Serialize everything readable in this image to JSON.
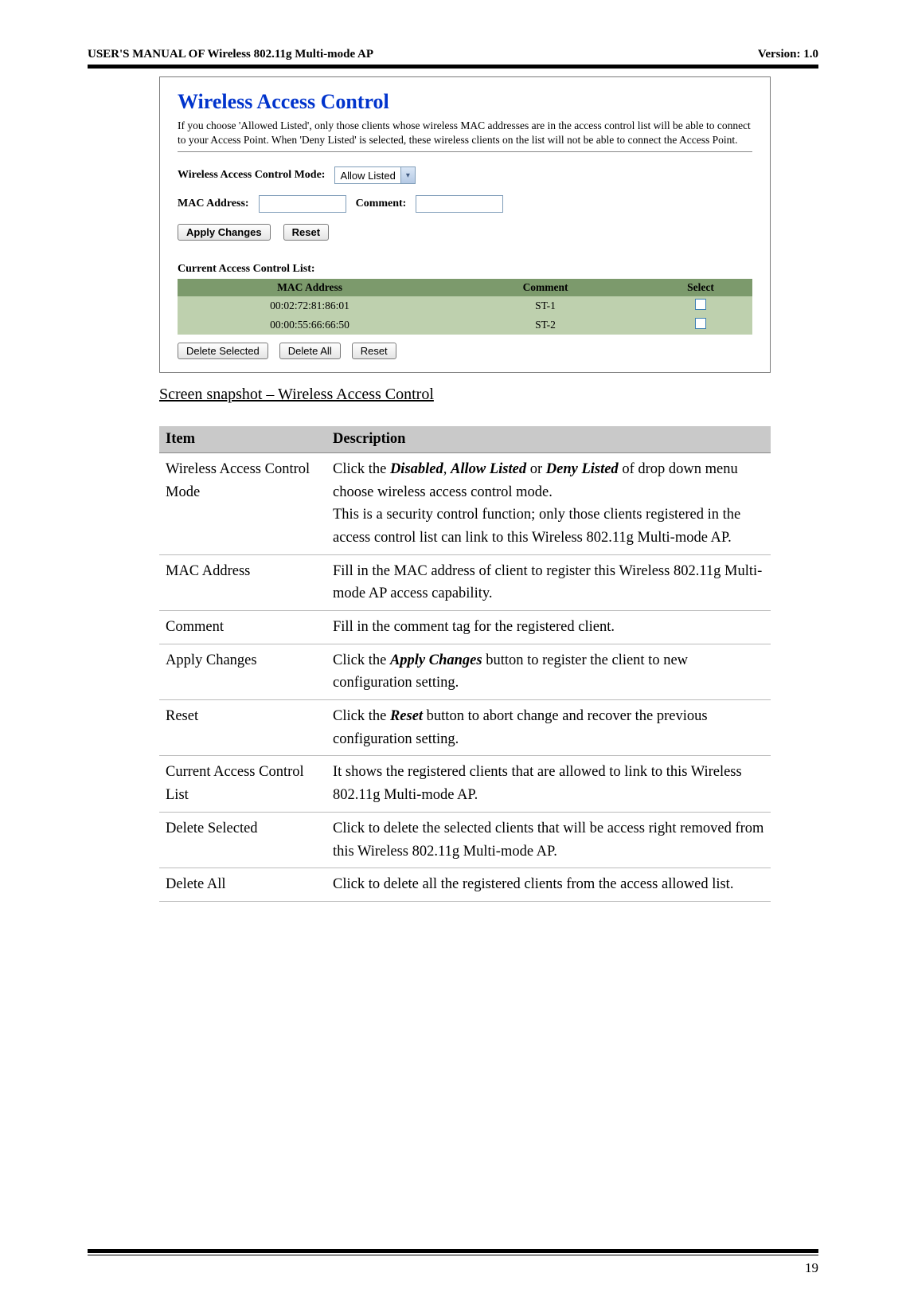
{
  "header": {
    "left": "USER'S MANUAL OF Wireless 802.11g Multi-mode AP",
    "right": "Version: 1.0"
  },
  "panel": {
    "title": "Wireless Access Control",
    "desc": "If you choose 'Allowed Listed', only those clients whose wireless MAC addresses are in the access control list will be able to connect to your Access Point. When 'Deny Listed' is selected, these wireless clients on the list will not be able to connect the Access Point.",
    "mode_label": "Wireless Access Control Mode:",
    "mode_value": "Allow Listed",
    "mac_label": "MAC Address:",
    "mac_value": "",
    "comment_label": "Comment:",
    "comment_value": "",
    "apply_btn": "Apply Changes",
    "reset_btn": "Reset",
    "list_title": "Current Access Control List:",
    "cols": {
      "mac": "MAC Address",
      "comment": "Comment",
      "select": "Select"
    },
    "rows": [
      {
        "mac": "00:02:72:81:86:01",
        "comment": "ST-1"
      },
      {
        "mac": "00:00:55:66:66:50",
        "comment": "ST-2"
      }
    ],
    "del_sel": "Delete Selected",
    "del_all": "Delete All",
    "reset2": "Reset"
  },
  "caption": "Screen snapshot – Wireless Access Control",
  "table": {
    "h1": "Item",
    "h2": "Description",
    "rows": [
      {
        "item": "Wireless Access Control Mode",
        "desc_parts": [
          "Click the ",
          {
            "b": "Disabled"
          },
          ", ",
          {
            "b": "Allow Listed"
          },
          " or ",
          {
            "b": "Deny Listed"
          },
          " of drop down menu choose wireless access control mode.\nThis is a security control function; only those clients registered in the access control list can link to this Wireless 802.11g Multi-mode AP."
        ]
      },
      {
        "item": "MAC Address",
        "desc_parts": [
          "Fill in the MAC address of client to register this Wireless 802.11g Multi-mode AP access capability."
        ]
      },
      {
        "item": "Comment",
        "desc_parts": [
          "Fill in the comment tag for the registered client."
        ]
      },
      {
        "item": "Apply Changes",
        "desc_parts": [
          "Click the ",
          {
            "b": "Apply Changes"
          },
          " button to register the client to new configuration setting."
        ]
      },
      {
        "item": "Reset",
        "desc_parts": [
          "Click the ",
          {
            "b": "Reset"
          },
          " button to abort change and recover the previous configuration setting."
        ]
      },
      {
        "item": "Current Access Control List",
        "desc_parts": [
          "It shows the registered clients that are allowed to link to this Wireless 802.11g Multi-mode AP."
        ]
      },
      {
        "item": "Delete Selected",
        "desc_parts": [
          "Click to delete the selected clients that will be access right removed from this Wireless 802.11g Multi-mode AP."
        ]
      },
      {
        "item": "Delete All",
        "desc_parts": [
          "Click to delete all the registered clients from the access allowed list."
        ]
      }
    ]
  },
  "page_num": "19"
}
